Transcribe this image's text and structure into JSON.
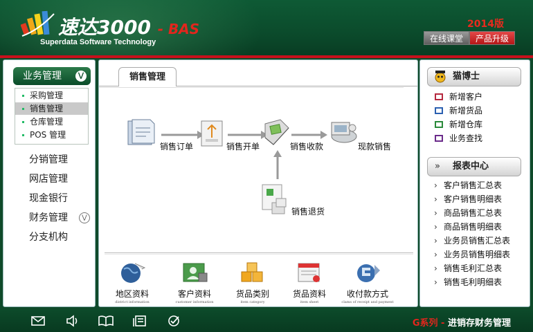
{
  "header": {
    "app_title": "速达3000",
    "edition": "- BAS",
    "subtitle": "Superdata Software Technology",
    "version": "2014版",
    "buttons": [
      "在线课堂",
      "产品升级"
    ]
  },
  "left_nav": {
    "head": "业务管理",
    "submenu": [
      {
        "label": "采购管理",
        "active": false
      },
      {
        "label": "销售管理",
        "active": true
      },
      {
        "label": "仓库管理",
        "active": false
      },
      {
        "label": "POS 管理",
        "active": false
      }
    ],
    "items": [
      "分销管理",
      "网店管理",
      "现金银行",
      "财务管理",
      "分支机构"
    ]
  },
  "center": {
    "tab": "销售管理",
    "flow": [
      "销售订单",
      "销售开单",
      "销售收款",
      "现款销售",
      "销售退货"
    ],
    "quick": [
      {
        "label": "地区资料",
        "en": "district information"
      },
      {
        "label": "客户资料",
        "en": "customer information"
      },
      {
        "label": "货品类别",
        "en": "item category"
      },
      {
        "label": "货品资料",
        "en": "item sheet"
      },
      {
        "label": "收付款方式",
        "en": "clams of receipt and payment"
      }
    ]
  },
  "right": {
    "section1": {
      "title": "猫博士",
      "items": [
        "新增客户",
        "新增货品",
        "新增仓库",
        "业务查找"
      ]
    },
    "section2": {
      "title": "报表中心",
      "items": [
        "客户销售汇总表",
        "客户销售明细表",
        "商品销售汇总表",
        "商品销售明细表",
        "业务员销售汇总表",
        "业务员销售明细表",
        "销售毛利汇总表",
        "销售毛利明细表"
      ]
    }
  },
  "footer": {
    "icons": [
      "mail-icon",
      "speaker-icon",
      "book-icon",
      "list-icon",
      "check-icon"
    ],
    "brand_series": "G系列",
    "brand_dash": " - ",
    "brand_text": "进销存财务管理"
  }
}
